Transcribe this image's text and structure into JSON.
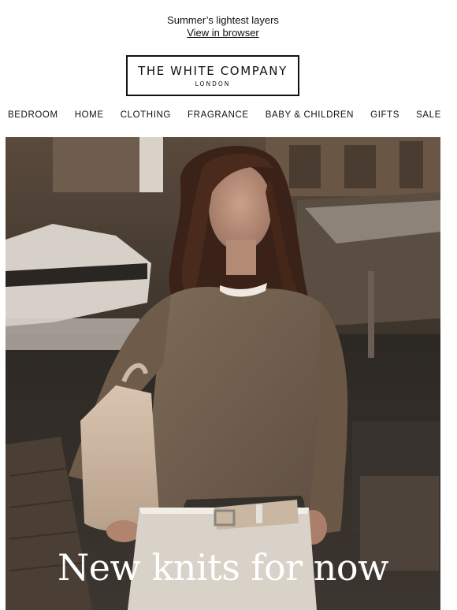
{
  "preheader": {
    "tagline": "Summer’s lightest layers",
    "view_in_browser": "View in browser"
  },
  "logo": {
    "brand": "THE WHITE COMPANY",
    "city": "LONDON"
  },
  "nav": {
    "items": [
      {
        "label": "BEDROOM"
      },
      {
        "label": "HOME"
      },
      {
        "label": "CLOTHING"
      },
      {
        "label": "FRAGRANCE"
      },
      {
        "label": "BABY & CHILDREN"
      },
      {
        "label": "GIFTS"
      },
      {
        "label": "SALE"
      }
    ]
  },
  "hero": {
    "headline": "New knits for now"
  }
}
